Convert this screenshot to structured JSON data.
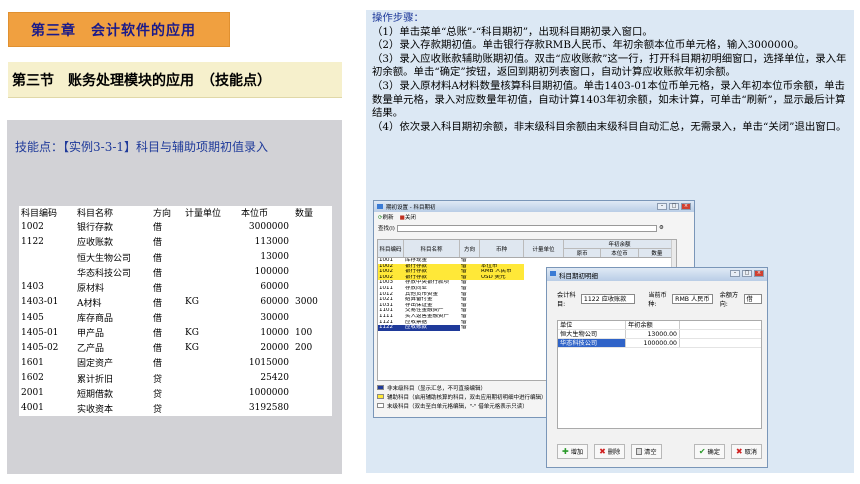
{
  "chapter_title": "第三章　会计软件的应用",
  "section_title": "第三节　账务处理模块的应用　（技能点）",
  "practice_title": "技能点：【实例3-3-1】科目与辅助项期初值录入",
  "table": {
    "headers": [
      "科目编码",
      "科目名称",
      "方向",
      "计量单位",
      "本位币",
      "数量"
    ],
    "rows": [
      [
        "1002",
        "银行存款",
        "借",
        "",
        "3000000",
        ""
      ],
      [
        "1122",
        "应收账款",
        "借",
        "",
        "113000",
        ""
      ],
      [
        "",
        "恒大生物公司",
        "借",
        "",
        "13000",
        ""
      ],
      [
        "",
        "华态科技公司",
        "借",
        "",
        "100000",
        ""
      ],
      [
        "1403",
        "原材料",
        "借",
        "",
        "60000",
        ""
      ],
      [
        "1403-01",
        "A材料",
        "借",
        "KG",
        "60000",
        "3000"
      ],
      [
        "1405",
        "库存商品",
        "借",
        "",
        "30000",
        ""
      ],
      [
        "1405-01",
        "甲产品",
        "借",
        "KG",
        "10000",
        "100"
      ],
      [
        "1405-02",
        "乙产品",
        "借",
        "KG",
        "20000",
        "200"
      ],
      [
        "1601",
        "固定资产",
        "借",
        "",
        "1015000",
        ""
      ],
      [
        "1602",
        "累计折旧",
        "贷",
        "",
        "25420",
        ""
      ],
      [
        "2001",
        "短期借款",
        "贷",
        "",
        "1000000",
        ""
      ],
      [
        "4001",
        "实收资本",
        "贷",
        "",
        "3192580",
        ""
      ]
    ]
  },
  "steps": {
    "heading": "操作步骤：",
    "items": [
      "（1）单击菜单“总账”-“科目期初”，出现科目期初录入窗口。",
      "（2）录入存款期初值。单击银行存款RMB人民币、年初余额本位币单元格，输入3000000。",
      "（3）录入应收账款辅助账期初值。双击“应收账款”这一行，打开科目期初明细窗口，选择单位，录入年初余额。单击“确定”按钮，返回到期初列表窗口，自动计算应收账款年初余额。",
      "（3）录入原材料A材料数量核算科目期初值。单击1403-01本位币单元格，录入年初本位币余额，单击数量单元格，录入对应数量年初值，自动计算1403年初余额，如未计算，可单击“刷新”，显示最后计算结果。",
      "（4）依次录入科目期初余额，非末级科目余额由末级科目自动汇总，无需录入，单击“关闭”退出窗口。"
    ]
  },
  "win1": {
    "title": "期初设置 - 科目期初",
    "toolbar": [
      "刷新",
      "关闭"
    ],
    "find_label": "查找(I)",
    "headers": [
      "科目编码",
      "科目名称",
      "方向",
      "币种",
      "计量单位",
      "年初余额"
    ],
    "subheaders": [
      "原币",
      "本位币",
      "数量"
    ],
    "rows": [
      [
        "1001",
        "库存现金",
        "借",
        ""
      ],
      [
        "1002",
        "银行存款",
        "借",
        "本位币"
      ],
      [
        "1002",
        "银行存款",
        "借",
        "RMB 人民币"
      ],
      [
        "1002",
        "银行存款",
        "借",
        "USD 美元"
      ],
      [
        "1003",
        "存放中央银行款项",
        "借",
        ""
      ],
      [
        "1011",
        "存放同业",
        "借",
        ""
      ],
      [
        "1012",
        "其他货币资金",
        "借",
        ""
      ],
      [
        "1021",
        "结算备付金",
        "借",
        ""
      ],
      [
        "1031",
        "存出保证金",
        "借",
        ""
      ],
      [
        "1101",
        "交易性金融资产",
        "借",
        ""
      ],
      [
        "1111",
        "买入返售金融资产",
        "借",
        ""
      ],
      [
        "1121",
        "应收票据",
        "借",
        ""
      ],
      [
        "1122",
        "应收账款",
        "借",
        ""
      ]
    ],
    "legend": [
      "非末级科目（显示汇总，不可直接编辑）",
      "辅助科目（启用辅助核算的科目，双击应用期初明细中进行编辑）",
      "末级科目（双击至白单元格编辑，\"-\" 借单元格表示只读）"
    ]
  },
  "win2": {
    "title": "科目期初明细",
    "account_label": "会计科目:",
    "account_value": "1122 应收账款",
    "currency_label": "当前币种:",
    "currency_value": "RMB 人民币",
    "direction_label": "余额方向:",
    "direction_value": "借",
    "headers": [
      "单位",
      "年初余额"
    ],
    "rows": [
      [
        "恒大生物公司",
        "13000.00"
      ],
      [
        "华态科技公司",
        "100000.00"
      ]
    ],
    "buttons": {
      "add": "增加",
      "delete": "删除",
      "clear": "清空",
      "ok": "确定",
      "cancel": "取消"
    }
  }
}
